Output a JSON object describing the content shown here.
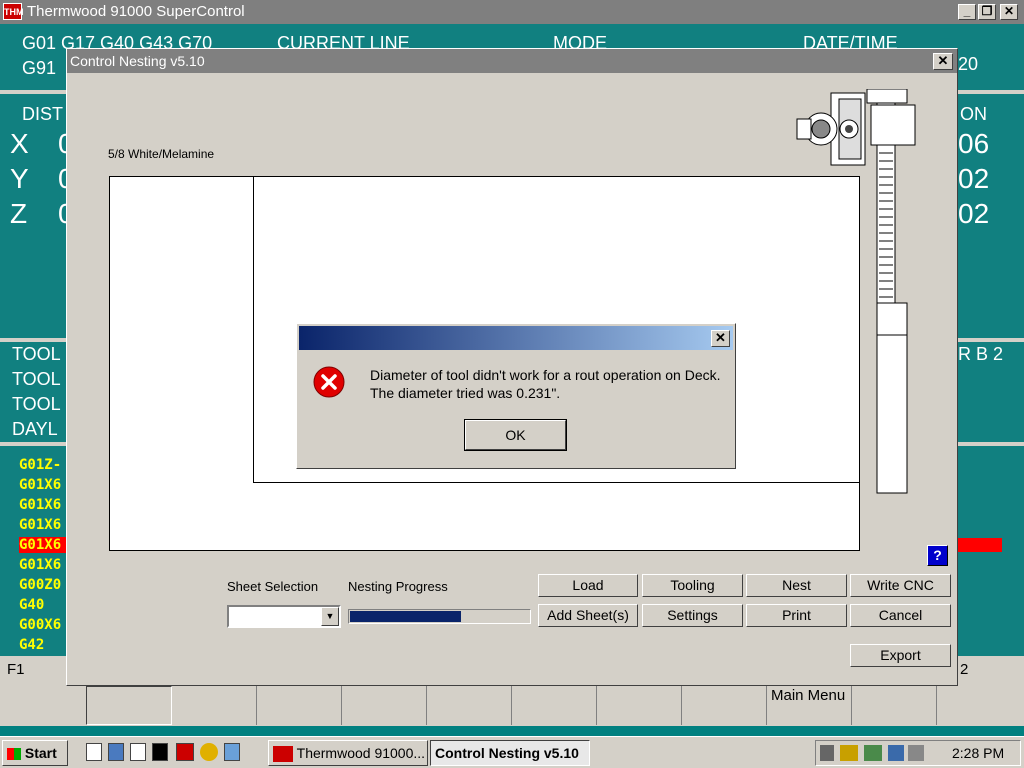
{
  "main_window": {
    "title": "Thermwood 91000 SuperControl",
    "logo": "THM"
  },
  "cnc": {
    "gcode_line1": "G01 G17 G40 G43 G70",
    "gcode_line2": "G91",
    "current_line_label": "CURRENT LINE",
    "mode_label": "MODE",
    "datetime_label": "DATE/TIME",
    "datetime_value_partial": "20",
    "dist_label": "DIST",
    "position_label_partial": "ON",
    "axes": [
      {
        "axis": "X",
        "left": "0",
        "right": "06"
      },
      {
        "axis": "Y",
        "left": "0",
        "right": "02"
      },
      {
        "axis": "Z",
        "left": "0",
        "right": "02"
      }
    ],
    "tool_labels": [
      "TOOL",
      "TOOL",
      "TOOL",
      "DAYL"
    ],
    "tool_right": "R B 2",
    "program_lines": [
      "G01Z-",
      "G01X6",
      "G01X6",
      "G01X6",
      "G01X6",
      "G01X6",
      "G00Z0",
      "G40",
      "G00X6",
      "G42"
    ],
    "highlighted_line_index": 4,
    "fkey_left": "F1",
    "fkey_right": "2",
    "main_menu_label": "Main Menu"
  },
  "nest_window": {
    "title": "Control Nesting v5.10",
    "material_label": "5/8 White/Melamine",
    "sheet_selection_label": "Sheet Selection",
    "nesting_progress_label": "Nesting Progress",
    "progress_fraction": 0.62,
    "buttons": {
      "load": "Load",
      "tooling": "Tooling",
      "nest": "Nest",
      "write_cnc": "Write CNC",
      "add_sheets": "Add Sheet(s)",
      "settings": "Settings",
      "print": "Print",
      "cancel": "Cancel",
      "export": "Export"
    },
    "help_icon": "?"
  },
  "error_dialog": {
    "message_line1": "Diameter of tool didn't work for a rout operation on Deck.",
    "message_line2": "The diameter tried was 0.231\".",
    "ok_label": "OK"
  },
  "taskbar": {
    "start_label": "Start",
    "tasks": [
      {
        "label": "Thermwood 91000..."
      },
      {
        "label": "Control Nesting v5.10"
      }
    ],
    "time": "2:28 PM"
  },
  "colors": {
    "cnc_bg": "#118080",
    "program_text": "#ffff00",
    "highlight": "#ff0000",
    "title_active": "#0a246a"
  }
}
